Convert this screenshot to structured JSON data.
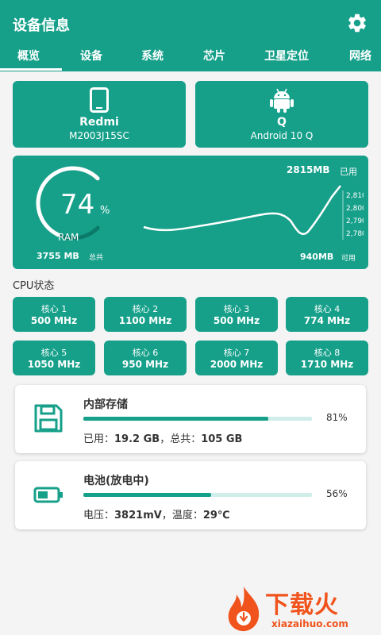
{
  "app": {
    "title": "设备信息"
  },
  "tabs": [
    {
      "label": "概览"
    },
    {
      "label": "设备"
    },
    {
      "label": "系统"
    },
    {
      "label": "芯片"
    },
    {
      "label": "卫星定位"
    },
    {
      "label": "网络"
    }
  ],
  "device": {
    "brand": "Redmi",
    "model": "M2003J15SC",
    "android_letter": "Q",
    "android_version": "Android 10 Q"
  },
  "ram": {
    "percent": "74",
    "percent_sign": "%",
    "label": "RAM",
    "total": "3755 MB",
    "total_label": "总共",
    "used": "2815MB",
    "used_label": "已用",
    "free": "940MB",
    "free_label": "可用",
    "usage_fraction": 0.74
  },
  "ram_chart": {
    "type": "line",
    "y_ticks": [
      "2,810",
      "2,800",
      "2,790",
      "2,780"
    ]
  },
  "cpu": {
    "title": "CPU状态",
    "cores": [
      {
        "name": "核心 1",
        "freq": "500 MHz"
      },
      {
        "name": "核心 2",
        "freq": "1100 MHz"
      },
      {
        "name": "核心 3",
        "freq": "500 MHz"
      },
      {
        "name": "核心 4",
        "freq": "774 MHz"
      },
      {
        "name": "核心 5",
        "freq": "1050 MHz"
      },
      {
        "name": "核心 6",
        "freq": "950 MHz"
      },
      {
        "name": "核心 7",
        "freq": "2000 MHz"
      },
      {
        "name": "核心 8",
        "freq": "1710 MHz"
      }
    ]
  },
  "storage": {
    "title": "内部存储",
    "percent": "81%",
    "fill_fraction": 0.81,
    "used_label": "已用：",
    "used": "19.2 GB",
    "total_label": "，总共：",
    "total": "105 GB"
  },
  "battery": {
    "title": "电池(放电中)",
    "percent": "56%",
    "fill_fraction": 0.56,
    "voltage_label": "电压：",
    "voltage": "3821mV",
    "temp_label": "，温度：",
    "temp": "29℃"
  },
  "watermark": {
    "text": "下载火",
    "url": "xiazaihuo.com"
  },
  "colors": {
    "primary": "#16a08a",
    "watermark": "#f0531c"
  },
  "icons": {
    "settings": "gear-icon",
    "phone": "phone-icon",
    "android": "android-icon",
    "storage": "floppy-disk-icon",
    "battery": "battery-icon"
  }
}
